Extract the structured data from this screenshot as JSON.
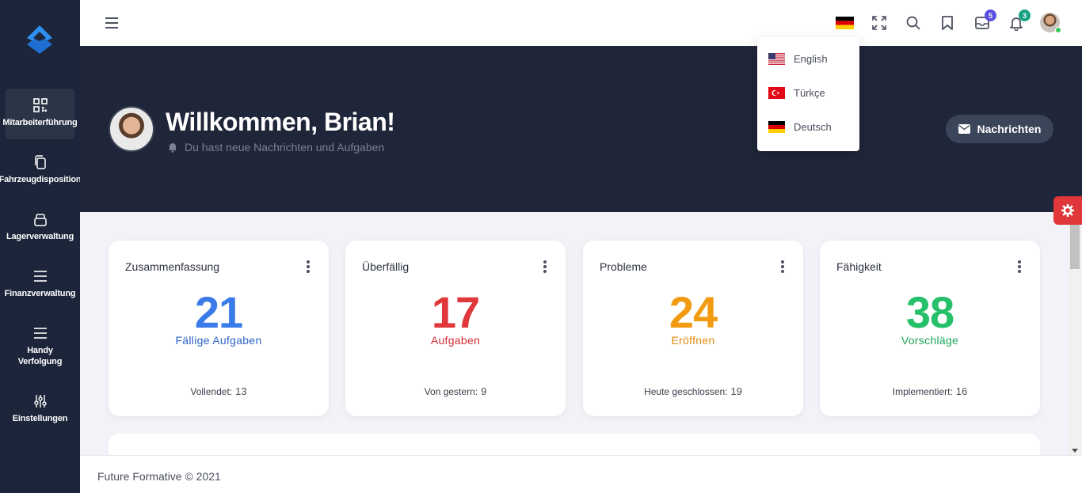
{
  "sidebar": {
    "logo_icon": "app-logo-icon",
    "items": [
      {
        "label": "Mitarbeiterführung",
        "icon": "qr-code-icon",
        "active": true
      },
      {
        "label": "Fahrzeugdisposition",
        "icon": "copy-icon"
      },
      {
        "label": "Lagerverwaltung",
        "icon": "box-icon"
      },
      {
        "label": "Finanzverwaltung",
        "icon": "menu-icon"
      },
      {
        "label": "Handy Verfolgung",
        "icon": "menu-icon"
      },
      {
        "label": "Einstellungen",
        "icon": "sliders-icon"
      }
    ]
  },
  "topbar": {
    "icons": [
      "hamburger-icon",
      "german-flag-icon",
      "fullscreen-icon",
      "search-icon",
      "bookmark-icon",
      "mail-icon",
      "bell-icon",
      "avatar"
    ],
    "mail_badge": "5",
    "bell_badge": "3",
    "mail_badge_color": "#5b4fe0",
    "bell_badge_color": "#1aa182"
  },
  "language_menu": {
    "options": [
      {
        "label": "English",
        "flag": "us-flag-icon"
      },
      {
        "label": "Türkçe",
        "flag": "turkey-flag-icon"
      },
      {
        "label": "Deutsch",
        "flag": "german-flag-icon"
      }
    ]
  },
  "hero": {
    "title": "Willkommen, Brian!",
    "subtitle": "Du hast neue Nachrichten und Aufgaben",
    "button_label": "Nachrichten"
  },
  "cards": [
    {
      "title": "Zusammenfassung",
      "value": "21",
      "label": "Fällige Aufgaben",
      "foot_label": "Vollendet:",
      "foot_value": "13",
      "color": "#3b7be9",
      "label_color": "#2f63c7"
    },
    {
      "title": "Überfällig",
      "value": "17",
      "label": "Aufgaben",
      "foot_label": "Von gestern:",
      "foot_value": "9",
      "color": "#e0373a",
      "label_color": "#d23034"
    },
    {
      "title": "Probleme",
      "value": "24",
      "label": "Eröffnen",
      "foot_label": "Heute geschlossen:",
      "foot_value": "19",
      "color": "#f29b11",
      "label_color": "#e08a0c"
    },
    {
      "title": "Fähigkeit",
      "value": "38",
      "label": "Vorschläge",
      "foot_label": "Implementiert:",
      "foot_value": "16",
      "color": "#26c06a",
      "label_color": "#1ea55a"
    }
  ],
  "footer": {
    "text": "Future Formative © 2021"
  }
}
